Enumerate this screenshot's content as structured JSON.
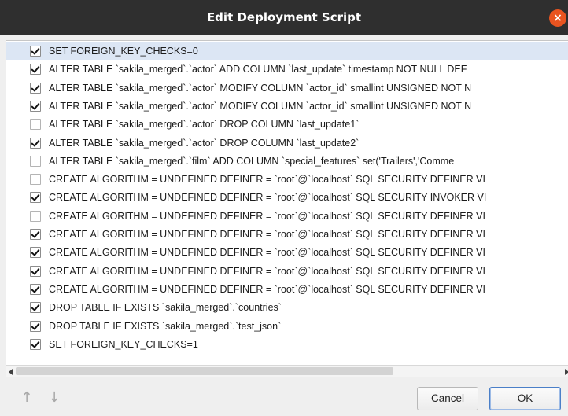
{
  "window": {
    "title": "Edit Deployment Script",
    "close_glyph": "×"
  },
  "statements": [
    {
      "checked": true,
      "text": "SET FOREIGN_KEY_CHECKS=0"
    },
    {
      "checked": true,
      "text": "ALTER TABLE `sakila_merged`.`actor` ADD COLUMN `last_update` timestamp NOT NULL DEF"
    },
    {
      "checked": true,
      "text": "ALTER TABLE `sakila_merged`.`actor` MODIFY COLUMN `actor_id` smallint UNSIGNED NOT N"
    },
    {
      "checked": true,
      "text": "ALTER TABLE `sakila_merged`.`actor` MODIFY COLUMN `actor_id` smallint UNSIGNED NOT N"
    },
    {
      "checked": false,
      "text": "ALTER TABLE `sakila_merged`.`actor` DROP COLUMN `last_update1`"
    },
    {
      "checked": true,
      "text": "ALTER TABLE `sakila_merged`.`actor` DROP COLUMN `last_update2`"
    },
    {
      "checked": false,
      "text": "ALTER TABLE `sakila_merged`.`film` ADD COLUMN `special_features` set('Trailers','Comme"
    },
    {
      "checked": false,
      "text": "CREATE ALGORITHM = UNDEFINED DEFINER = `root`@`localhost` SQL SECURITY DEFINER VI"
    },
    {
      "checked": true,
      "text": "CREATE ALGORITHM = UNDEFINED DEFINER = `root`@`localhost` SQL SECURITY INVOKER VI"
    },
    {
      "checked": false,
      "text": "CREATE ALGORITHM = UNDEFINED DEFINER = `root`@`localhost` SQL SECURITY DEFINER VI"
    },
    {
      "checked": true,
      "text": "CREATE ALGORITHM = UNDEFINED DEFINER = `root`@`localhost` SQL SECURITY DEFINER VI"
    },
    {
      "checked": true,
      "text": "CREATE ALGORITHM = UNDEFINED DEFINER = `root`@`localhost` SQL SECURITY DEFINER VI"
    },
    {
      "checked": true,
      "text": "CREATE ALGORITHM = UNDEFINED DEFINER = `root`@`localhost` SQL SECURITY DEFINER VI"
    },
    {
      "checked": true,
      "text": "CREATE ALGORITHM = UNDEFINED DEFINER = `root`@`localhost` SQL SECURITY DEFINER VI"
    },
    {
      "checked": true,
      "text": "DROP TABLE IF EXISTS `sakila_merged`.`countries`"
    },
    {
      "checked": true,
      "text": "DROP TABLE IF EXISTS `sakila_merged`.`test_json`"
    },
    {
      "checked": true,
      "text": "SET FOREIGN_KEY_CHECKS=1"
    }
  ],
  "selected_index": 0,
  "footer": {
    "move_up_glyph": "↑",
    "move_down_glyph": "↓",
    "cancel_label": "Cancel",
    "ok_label": "OK"
  },
  "colors": {
    "titlebar": "#2f2f2f",
    "close_button": "#e95420",
    "selection": "#dce6f4",
    "ok_focus": "#4a7fc8"
  },
  "icons": {
    "close": "close-icon",
    "move_up": "arrow-up-icon",
    "move_down": "arrow-down-icon"
  }
}
